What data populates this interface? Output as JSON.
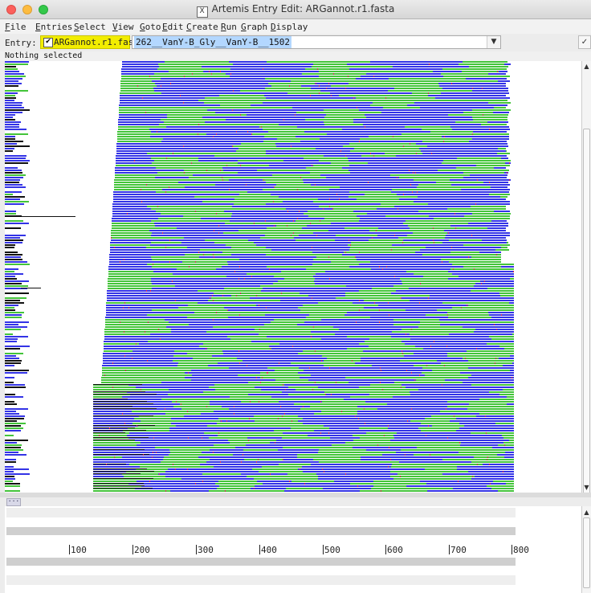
{
  "window": {
    "title": "Artemis Entry Edit: ARGannot.r1.fasta",
    "lights": {
      "close": "#fc605c",
      "minimize": "#fdbc40",
      "zoom": "#34c84a"
    }
  },
  "menu": [
    {
      "key": "file",
      "first": "F",
      "rest": "ile"
    },
    {
      "key": "entries",
      "first": "E",
      "rest": "ntries"
    },
    {
      "key": "select",
      "first": "S",
      "rest": "elect"
    },
    {
      "key": "view",
      "first": "V",
      "rest": "iew"
    },
    {
      "key": "goto",
      "first": "G",
      "rest": "oto"
    },
    {
      "key": "edit",
      "first": "E",
      "rest": "dit"
    },
    {
      "key": "create",
      "first": "C",
      "rest": "reate"
    },
    {
      "key": "run",
      "first": "R",
      "rest": "un"
    },
    {
      "key": "graph",
      "first": "G",
      "rest": "raph"
    },
    {
      "key": "display",
      "first": "D",
      "rest": "isplay"
    }
  ],
  "entry": {
    "label": "Entry:",
    "file": "ARGannot.r1.fasta",
    "checked": "✔",
    "selected": "262__VanY-B_Gly__VanY-B__1502",
    "ok": "✓"
  },
  "status": "Nothing selected",
  "colors": {
    "blue": "#3333e6",
    "green": "#43c43a",
    "mismatch": "#d6204a",
    "chip": "#f2ed00"
  },
  "ruler": {
    "labels": [
      "100",
      "200",
      "300",
      "400",
      "500",
      "600",
      "700",
      "800"
    ]
  },
  "handle": "···"
}
